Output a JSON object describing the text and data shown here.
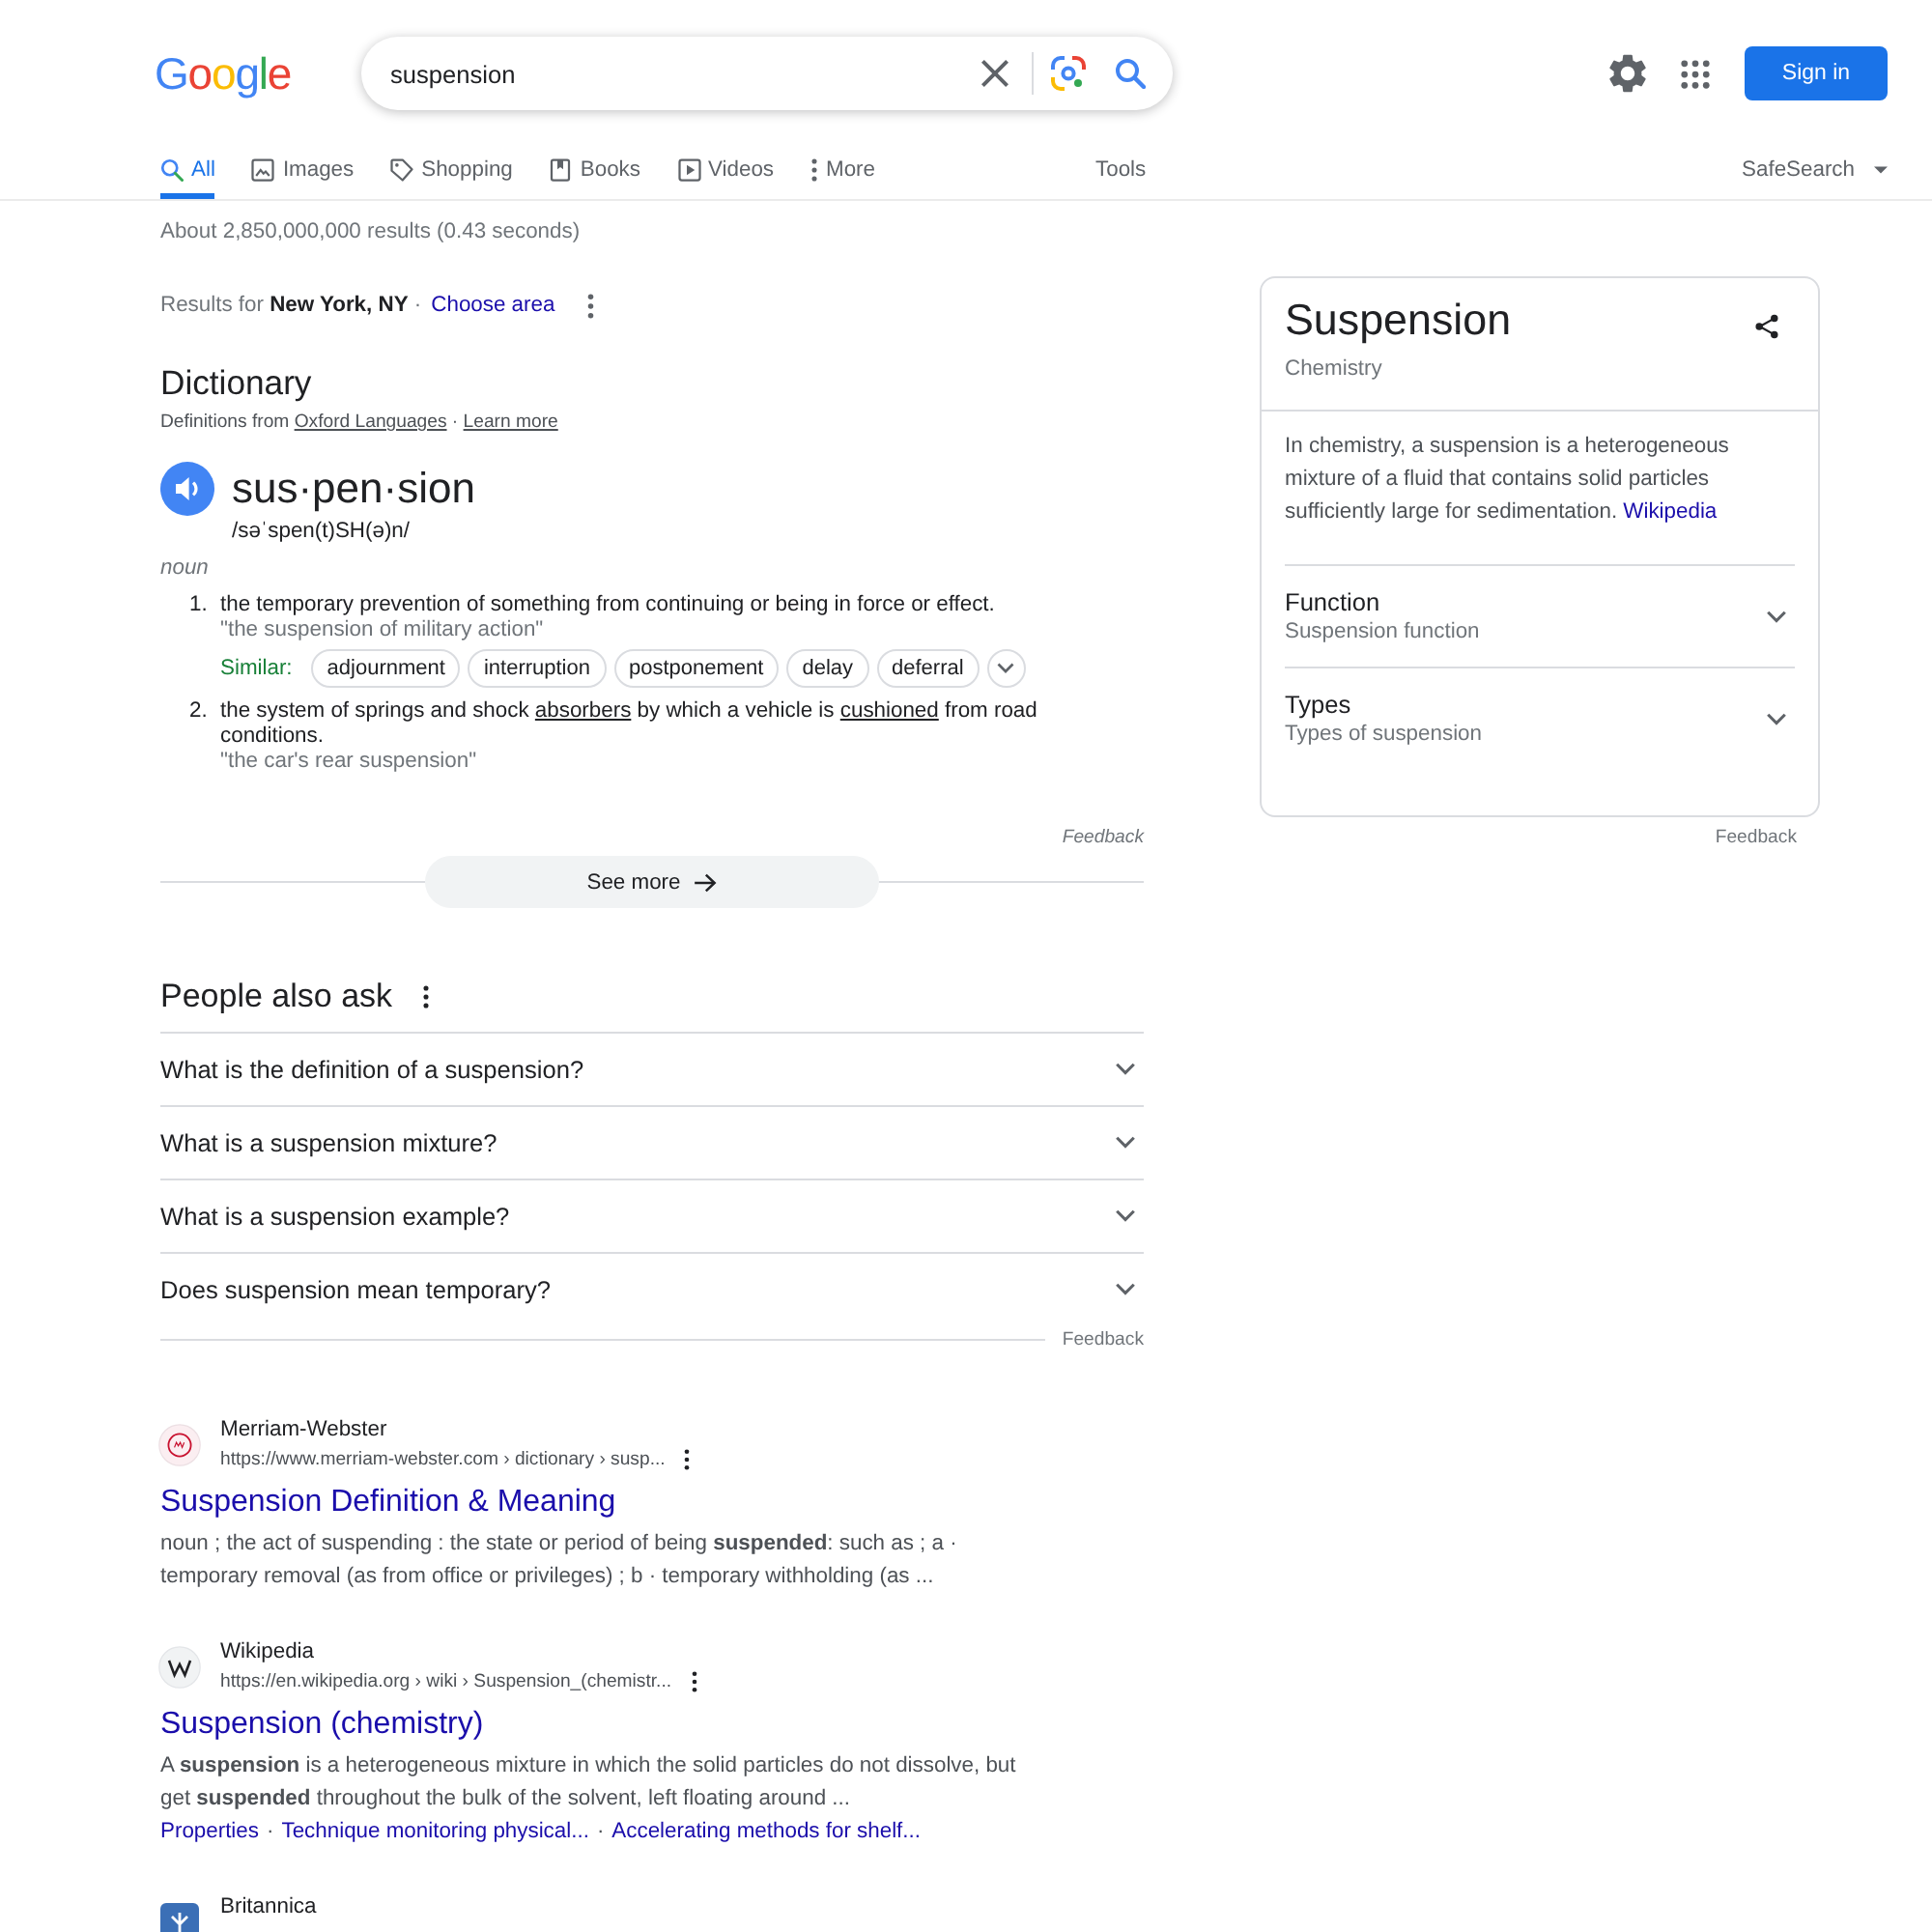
{
  "header": {
    "logo": "Google",
    "search": {
      "value": "suspension"
    },
    "sign_in": "Sign in"
  },
  "tabs": [
    {
      "label": "All",
      "kind": "search",
      "selected": true
    },
    {
      "label": "Images",
      "kind": "image",
      "selected": false
    },
    {
      "label": "Shopping",
      "kind": "tag",
      "selected": false
    },
    {
      "label": "Books",
      "kind": "book",
      "selected": false
    },
    {
      "label": "Videos",
      "kind": "play",
      "selected": false
    },
    {
      "label": "More",
      "kind": "more",
      "selected": false
    }
  ],
  "tools": "Tools",
  "safesearch": "SafeSearch",
  "result_stats": "About 2,850,000,000 results (0.43 seconds)",
  "location": {
    "text": "Results for **New York, NY** ·",
    "link": "Choose area"
  },
  "dictionary": {
    "title": "Dictionary",
    "source": {
      "text": "Definitions from",
      "link": "Oxford Languages",
      "separator": "·",
      "learn_more": "Learn more"
    },
    "headword": "sus·pen·sion",
    "phonetic": "/səˈspen(t)SH(ə)n/",
    "part_of_speech": "noun",
    "senses": [
      {
        "number": "1.",
        "parts": [
          {
            "kind": "plain",
            "text": "the temporary prevention of something from continuing or being in force or effect."
          }
        ],
        "example": "\"the suspension of military action\"",
        "similar_label": "Similar:",
        "similar": [
          "adjournment",
          "interruption",
          "postponement",
          "delay",
          "deferral"
        ]
      },
      {
        "number": "2.",
        "parts": [
          {
            "kind": "plain",
            "text": "the system of springs and shock "
          },
          {
            "kind": "link",
            "text": "absorbers"
          },
          {
            "kind": "plain",
            "text": " by which a vehicle is "
          },
          {
            "kind": "link",
            "text": "cushioned"
          },
          {
            "kind": "plain",
            "text": " from road conditions."
          }
        ],
        "example": "\"the car's rear suspension\""
      }
    ],
    "feedback": "Feedback",
    "see_more": "See more"
  },
  "people_also_ask": {
    "title": "People also ask",
    "questions": [
      {
        "text": "What is the definition of a suspension?",
        "expanded": false
      },
      {
        "text": "What is a suspension mixture?",
        "expanded": false
      },
      {
        "text": "What is a suspension example?",
        "expanded": false
      },
      {
        "text": "Does suspension mean temporary?",
        "expanded": false
      }
    ],
    "feedback": "Feedback"
  },
  "results": [
    {
      "favicon": {
        "kind": "ring"
      },
      "site": "Merriam-Webster",
      "url": "https://www.merriam-webster.com › dictionary › susp...",
      "title": "Suspension Definition & Meaning",
      "snippet": "noun ; the act of suspending : the state or period of being **suspended**: such as ; a · temporary removal (as from office or privileges) ; b · temporary withholding (as ..."
    },
    {
      "favicon": {
        "kind": "w"
      },
      "site": "Wikipedia",
      "url": "https://en.wikipedia.org › wiki › Suspension_(chemistr...",
      "title": "Suspension (chemistry)",
      "snippet": "A **suspension** is a heterogeneous mixture in which the solid particles do not dissolve, but get **suspended** throughout the bulk of the solvent, left floating around ...",
      "sitelinks": [
        "Properties",
        "Technique monitoring physical...",
        "Accelerating methods for shelf..."
      ],
      "sitelink_separator": "·"
    },
    {
      "favicon": {
        "kind": "thistle"
      },
      "site": "Britannica"
    }
  ],
  "knowledge_panel": {
    "title": "Suspension",
    "subtitle": "Chemistry",
    "description": "In chemistry, a suspension is a heterogeneous mixture of a fluid that contains solid particles sufficiently large for sedimentation.",
    "source_link": "Wikipedia",
    "sections": [
      {
        "title": "Function",
        "subtitle": "Suspension function",
        "expanded": false
      },
      {
        "title": "Types",
        "subtitle": "Types of suspension",
        "expanded": false
      }
    ],
    "feedback": "Feedback"
  }
}
